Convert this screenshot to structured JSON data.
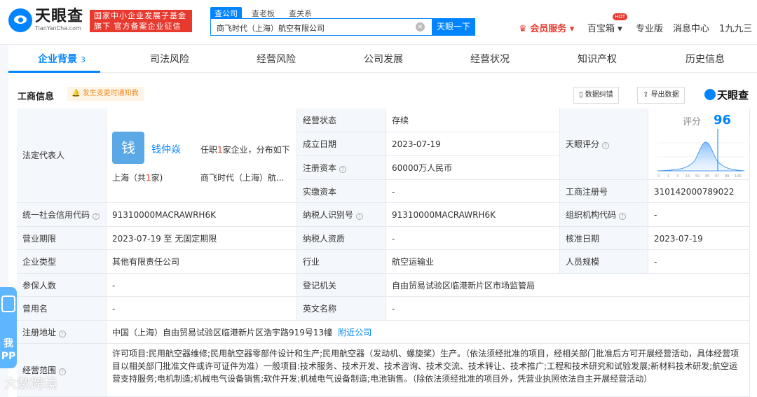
{
  "brand": {
    "name": "天眼查",
    "domain_text": "TianYanCha.com",
    "badge": "国家中小企业发展子基金旗下 官方备案企业征信机构"
  },
  "search": {
    "tabs": [
      "查公司",
      "查老板",
      "查关系"
    ],
    "value": "商飞时代（上海）航空有限公司",
    "button": "天眼一下",
    "clear": "×"
  },
  "nav": {
    "vip": "会员服务",
    "hot": "HOT",
    "box": "百宝箱",
    "pro": "专业版",
    "msg": "消息中心",
    "user": "1九九三"
  },
  "tabs": [
    "企业背景",
    "司法风险",
    "经营风险",
    "公司发展",
    "经营状况",
    "知识产权",
    "历史信息"
  ],
  "tab_count": "3",
  "section": {
    "title": "工商信息",
    "notify": "发生变更时通知我",
    "correct": "数据纠错",
    "export": "导出数据",
    "logo": "天眼查"
  },
  "legal": {
    "label": "法定代表人",
    "avatar": "钱",
    "name": "钱仲焱",
    "desc_prefix": "任职",
    "desc_count": "1",
    "desc_suffix": "家企业，分布如下",
    "region": "上海（共",
    "region_count": "1",
    "region_suffix": "家)",
    "company_short": "商飞时代（上海）航..."
  },
  "score": {
    "label": "评分",
    "value": "96",
    "ticks": [
      "0",
      "1",
      "3",
      "15",
      "50",
      "85",
      "97",
      "99",
      "100"
    ],
    "tianyan_label": "天眼评分"
  },
  "fields": {
    "status_label": "经营状态",
    "status": "存续",
    "founded_label": "成立日期",
    "founded": "2023-07-19",
    "capital_label": "注册资本",
    "capital": "60000万人民币",
    "paid_label": "实缴资本",
    "paid": "-",
    "reg_no_label": "工商注册号",
    "reg_no": "310142000789022",
    "credit_label": "统一社会信用代码",
    "credit": "91310000MACRAWRH6K",
    "tax_label": "纳税人识别号",
    "tax": "91310000MACRAWRH6K",
    "org_label": "组织机构代码",
    "org": "-",
    "term_label": "营业期限",
    "term": "2023-07-19 至 无固定期限",
    "taxpayer_label": "纳税人资质",
    "taxpayer": "-",
    "approve_label": "核准日期",
    "approve": "2023-07-19",
    "type_label": "企业类型",
    "type": "其他有限责任公司",
    "industry_label": "行业",
    "industry": "航空运输业",
    "staff_label": "人员规模",
    "staff": "-",
    "insured_label": "参保人数",
    "insured": "-",
    "authority_label": "登记机关",
    "authority": "自由贸易试验区临港新片区市场监管局",
    "former_label": "曾用名",
    "former": "-",
    "english_label": "英文名称",
    "english": "-",
    "address_label": "注册地址",
    "address": "中国（上海）自由贸易试验区临港新片区浩宇路919号13幢",
    "address_link": "附近公司",
    "scope_label": "经营范围",
    "scope": "许可项目:民用航空器维修;民用航空器零部件设计和生产;民用航空器（发动机、螺旋桨）生产。（依法须经批准的项目，经相关部门批准后方可开展经营活动，具体经营项目以相关部门批准文件或许可证件为准）一般项目:技术服务、技术开发、技术咨询、技术交流、技术转让、技术推广;工程和技术研究和试验发展;新材料技术研发;航空运营支持服务;电机制造;机械电气设备销售;软件开发;机械电气设备制造;电池销售。（除依法须经批准的项目外，凭营业执照依法自主开展经营活动）"
  },
  "float": {
    "text": "我 PP"
  },
  "watermark": "大数跨境",
  "colors": {
    "accent": "#0084ff",
    "red": "#e8392f",
    "label_bg": "#f4f7fb"
  }
}
